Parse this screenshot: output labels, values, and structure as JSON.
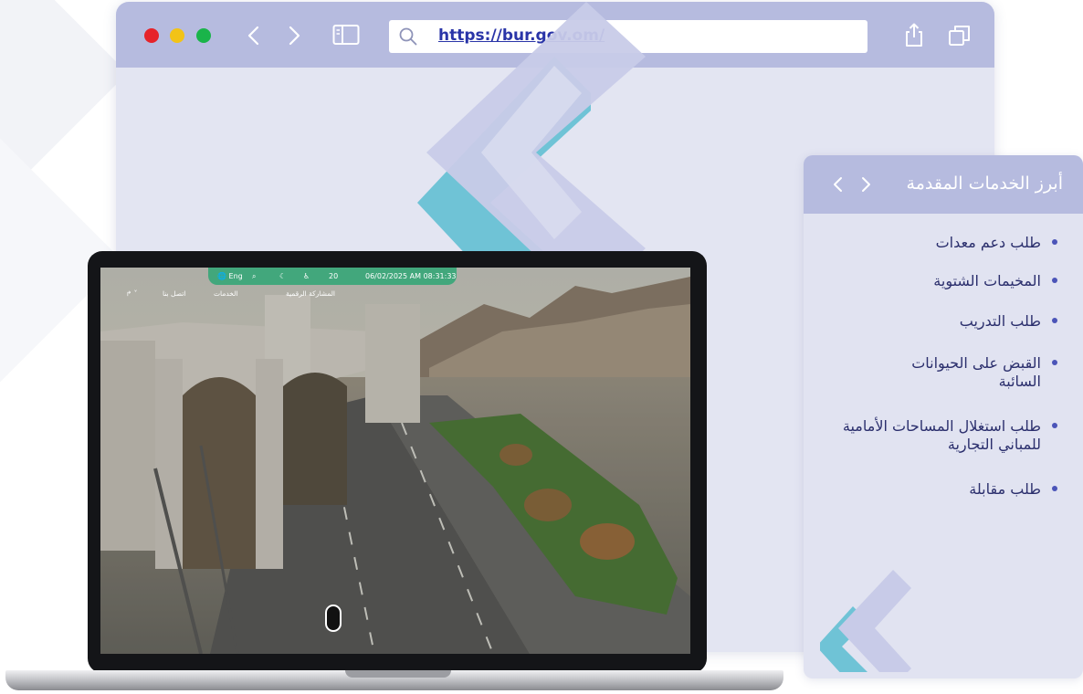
{
  "browser": {
    "url": "https://bur.gov.om/",
    "icons": {
      "back": "chevron-left-icon",
      "forward": "chevron-right-icon",
      "sidebar": "sidebar-icon",
      "search": "search-icon",
      "share": "share-icon",
      "tabs": "tabs-icon"
    },
    "colors": {
      "toolbar": "#b6bbdf",
      "window": "#e3e5f2",
      "url": "#2a35a8"
    }
  },
  "laptop_site": {
    "topbar": {
      "language": "Eng",
      "temperature": "20",
      "datetime": "06/02/2025  AM 08:31:33"
    },
    "nav": {
      "contact": "اتصل بنا",
      "services": "الخدمات",
      "digital": "المشاركة الرقمية"
    }
  },
  "services": {
    "title": "أبرز الخدمات المقدمة",
    "items": [
      {
        "label": "طلب دعم معدات"
      },
      {
        "label": "المخيمات الشتوية"
      },
      {
        "label": "طلب التدريب"
      },
      {
        "label": "القبض على الحيوانات السائبة"
      },
      {
        "label": "طلب استغلال المساحات الأمامية للمباني التجارية"
      },
      {
        "label": "طلب مقابلة"
      }
    ],
    "colors": {
      "header": "#b6bbdf",
      "card": "#e1e3f1",
      "text": "#2b2f6d",
      "bullet": "#4b54b8"
    }
  },
  "decor": {
    "chevron_colors": {
      "lavender": "#c8cbe8",
      "teal": "#6fc3d6"
    }
  }
}
